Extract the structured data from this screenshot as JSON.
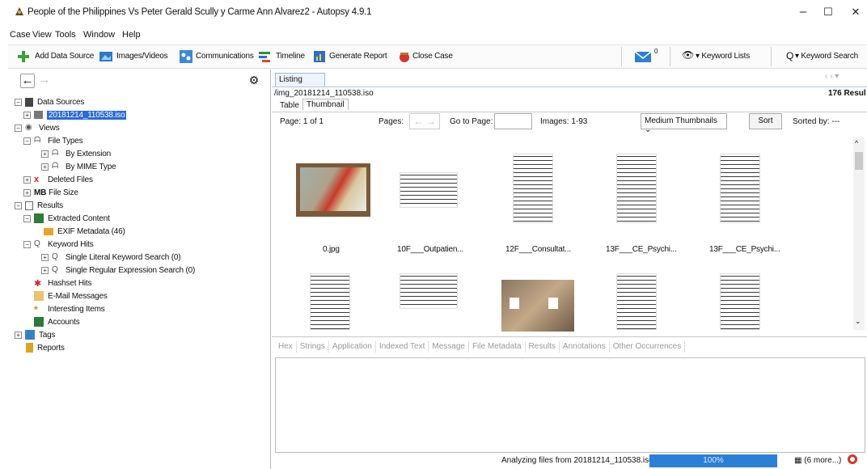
{
  "window": {
    "title": "People of the Philippines Vs Peter Gerald Scully y Carme Ann Alvarez2 - Autopsy 4.9.1",
    "minimize": "–",
    "maximize": "☐",
    "close": "✕"
  },
  "menu": [
    "Case",
    "View",
    "Tools",
    "Window",
    "Help"
  ],
  "toolbar": {
    "add_data_source": "Add Data Source",
    "images_videos": "Images/Videos",
    "communications": "Communications",
    "timeline": "Timeline",
    "generate_report": "Generate Report",
    "close_case": "Close Case",
    "mail_badge": "0",
    "keyword_lists": "Keyword Lists",
    "keyword_search": "Keyword Search"
  },
  "tree": {
    "data_sources": "Data Sources",
    "selected_source": "20181214_110538.iso",
    "views": "Views",
    "file_types": "File Types",
    "by_extension": "By Extension",
    "by_mime": "By MIME Type",
    "deleted_files": "Deleted Files",
    "file_size": "File Size",
    "results": "Results",
    "extracted_content": "Extracted Content",
    "exif": "EXIF Metadata (46)",
    "keyword_hits": "Keyword Hits",
    "single_literal": "Single Literal Keyword Search (0)",
    "single_regex": "Single Regular Expression Search (0)",
    "hashset_hits": "Hashset Hits",
    "email": "E-Mail Messages",
    "interesting": "Interesting Items",
    "accounts": "Accounts",
    "tags": "Tags",
    "reports": "Reports"
  },
  "listing": {
    "tab": "Listing",
    "path": "/img_20181214_110538.iso",
    "result_count": "176 Resul",
    "subtabs": [
      "Table",
      "Thumbnail"
    ],
    "page_label": "Page: 1 of 1",
    "pages_label": "Pages:",
    "goto_label": "Go to Page:",
    "goto_value": "",
    "images_label": "Images: 1-93",
    "thumb_size": "Medium Thumbnails",
    "sort_button": "Sort",
    "sorted_by": "Sorted by: ---",
    "thumbnails": [
      {
        "caption": "0.jpg",
        "kind": "photo"
      },
      {
        "caption": "10F___Outpatien...",
        "kind": "doc"
      },
      {
        "caption": "12F___Consultat...",
        "kind": "doc"
      },
      {
        "caption": "13F___CE_Psychi...",
        "kind": "doc"
      },
      {
        "caption": "13F___CE_Psychi...",
        "kind": "doc"
      },
      {
        "caption": "",
        "kind": "doc"
      },
      {
        "caption": "",
        "kind": "doc"
      },
      {
        "caption": "",
        "kind": "photo"
      },
      {
        "caption": "",
        "kind": "doc"
      },
      {
        "caption": "",
        "kind": "doc"
      }
    ]
  },
  "content_tabs": [
    "Hex",
    "Strings",
    "Application",
    "Indexed Text",
    "Message",
    "File Metadata",
    "Results",
    "Annotations",
    "Other Occurrences"
  ],
  "status": {
    "text": "Analyzing files from 20181214_110538.iso",
    "progress": "100%",
    "more": "(6 more...)"
  },
  "colors": {
    "selection": "#2b6ad6",
    "progress": "#2c7fd6",
    "close_icon": "#d7352b"
  }
}
